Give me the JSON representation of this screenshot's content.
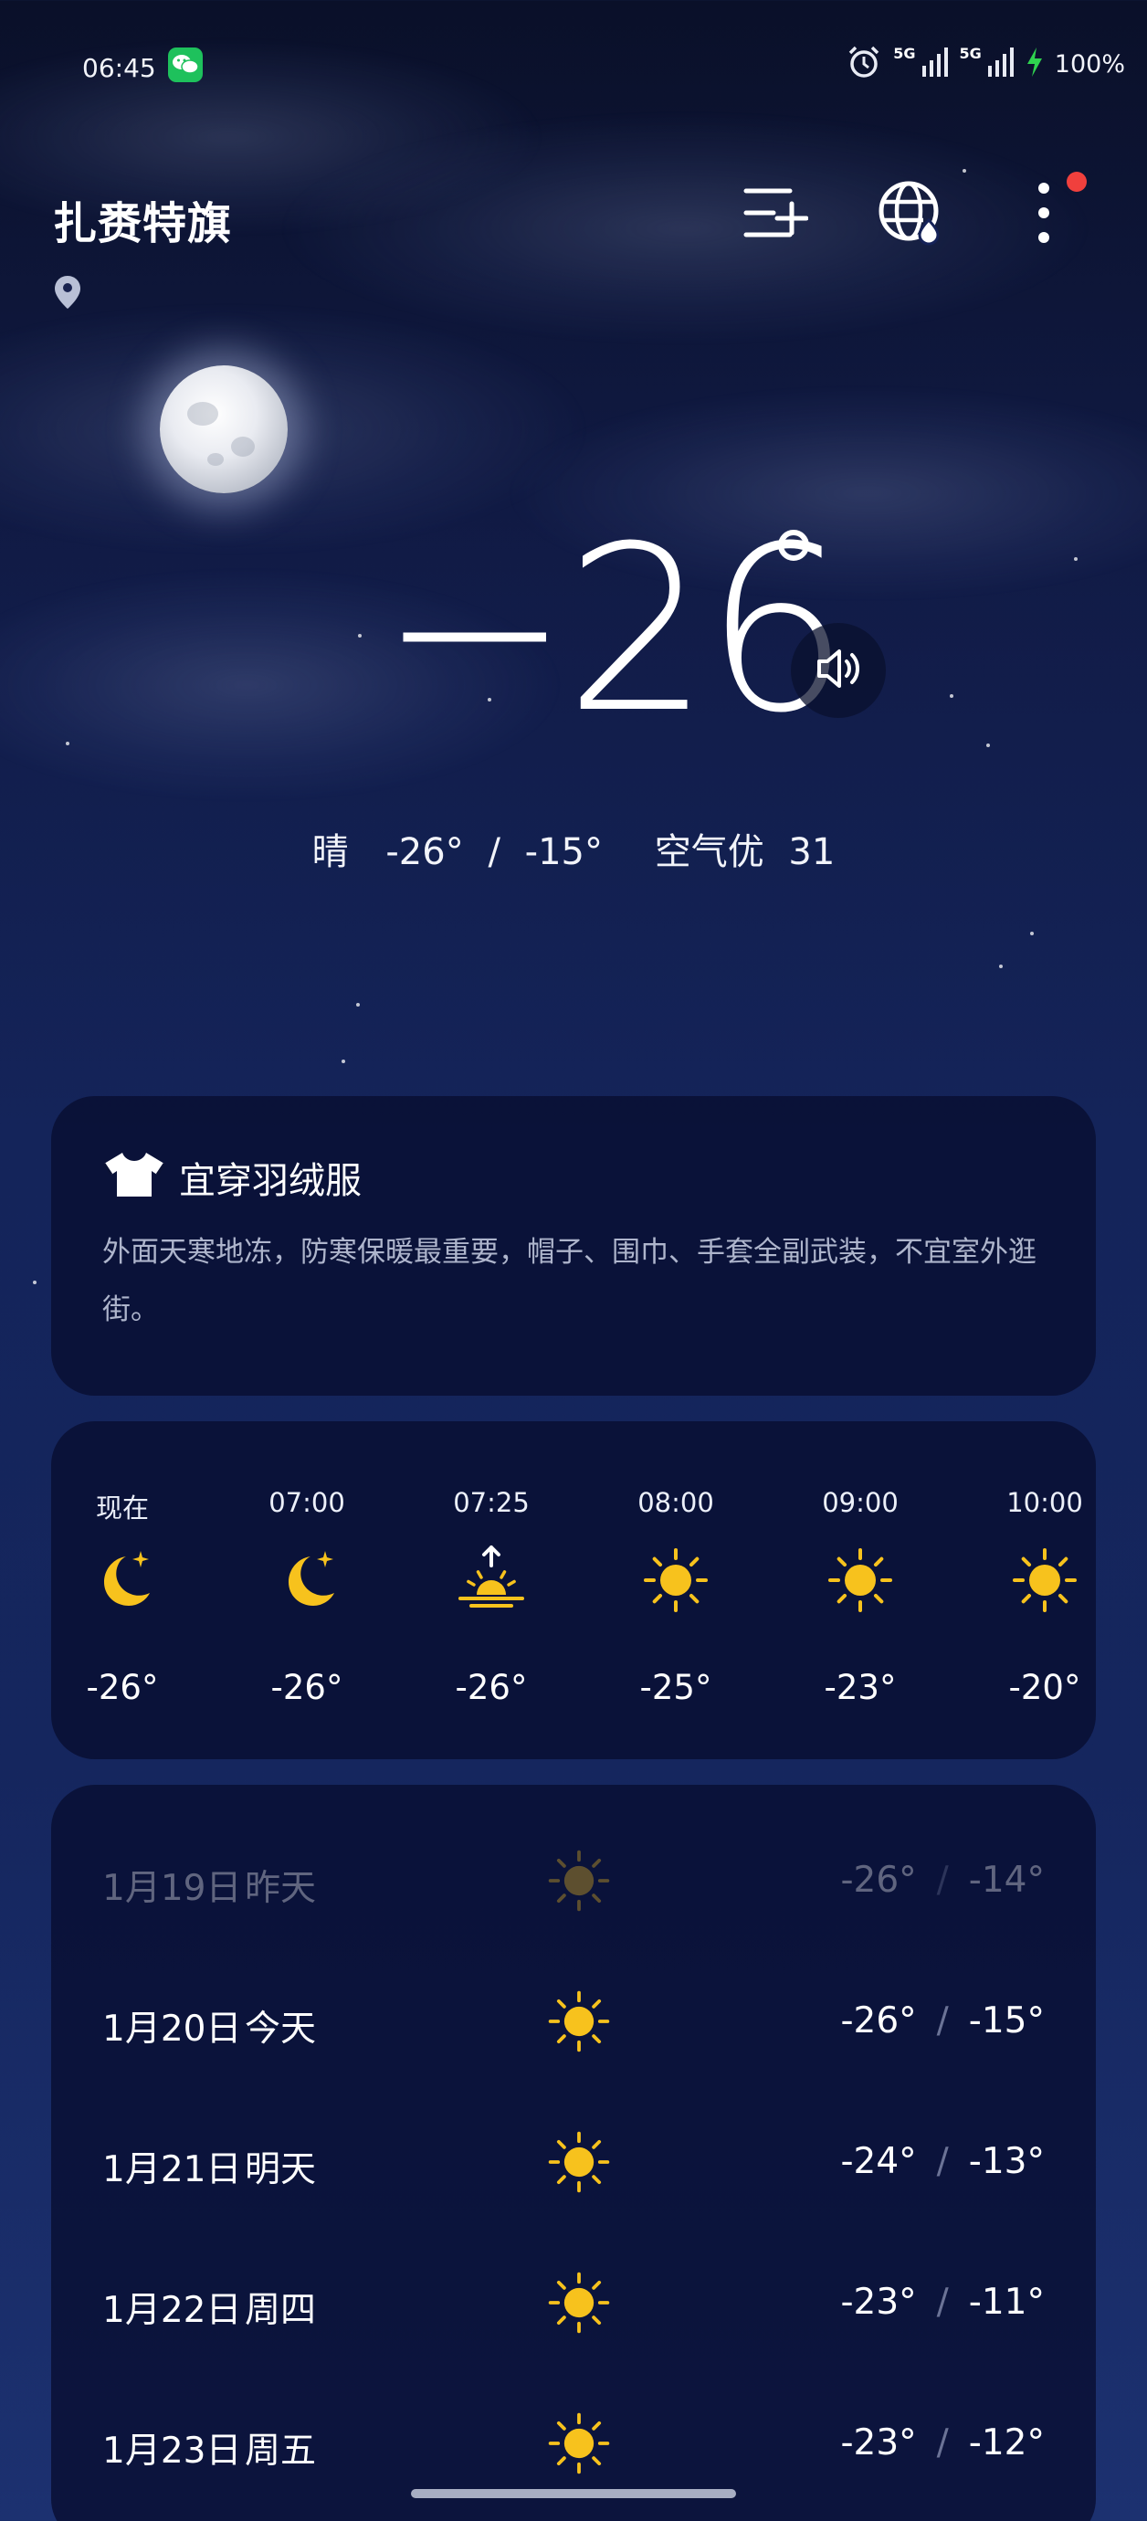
{
  "status_bar": {
    "time": "06:45",
    "signal_1_label": "5G",
    "signal_2_label": "5G",
    "battery": "100%",
    "icons": [
      "wechat-icon",
      "alarm-icon",
      "signal-icon",
      "charging-icon"
    ]
  },
  "header": {
    "city": "扎赉特旗",
    "icons": [
      "location-pin-icon",
      "add-city-icon",
      "globe-icon",
      "more-icon"
    ]
  },
  "current": {
    "temperature": "−26",
    "condition": "晴",
    "low": "-26°",
    "sep": "/",
    "high": "-15°",
    "air_label": "空气优",
    "aqi": "31"
  },
  "clothing": {
    "title": "宜穿羽绒服",
    "description": "外面天寒地冻，防寒保暖最重要，帽子、围巾、手套全副武装，不宜室外逛街。"
  },
  "hourly": [
    {
      "time": "现在",
      "icon": "moon-star-icon",
      "temp": "-26°"
    },
    {
      "time": "07:00",
      "icon": "moon-star-icon",
      "temp": "-26°"
    },
    {
      "time": "07:25",
      "icon": "sunrise-icon",
      "temp": "-26°"
    },
    {
      "time": "08:00",
      "icon": "sun-icon",
      "temp": "-25°"
    },
    {
      "time": "09:00",
      "icon": "sun-icon",
      "temp": "-23°"
    },
    {
      "time": "10:00",
      "icon": "sun-icon",
      "temp": "-20°"
    }
  ],
  "daily": [
    {
      "date": "1月19日",
      "day": "昨天",
      "icon": "sun-icon",
      "low": "-26°",
      "high": "-14°",
      "past": true
    },
    {
      "date": "1月20日",
      "day": "今天",
      "icon": "sun-icon",
      "low": "-26°",
      "high": "-15°",
      "past": false
    },
    {
      "date": "1月21日",
      "day": "明天",
      "icon": "sun-icon",
      "low": "-24°",
      "high": "-13°",
      "past": false
    },
    {
      "date": "1月22日",
      "day": "周四",
      "icon": "sun-icon",
      "low": "-23°",
      "high": "-11°",
      "past": false
    },
    {
      "date": "1月23日",
      "day": "周五",
      "icon": "sun-icon",
      "low": "-23°",
      "high": "-12°",
      "past": false
    }
  ],
  "daily_sep": "/",
  "colors": {
    "sun": "#f7c21d",
    "accent_red": "#f0403d",
    "wechat": "#1ec15c",
    "charging": "#2fd34f"
  }
}
